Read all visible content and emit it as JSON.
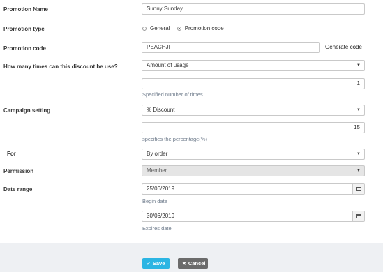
{
  "form": {
    "promotion_name": {
      "label": "Promotion Name",
      "value": "Sunny Sunday"
    },
    "promotion_type": {
      "label": "Promotion type",
      "options": [
        {
          "label": "General",
          "checked": false
        },
        {
          "label": "Promotion code",
          "checked": true
        }
      ]
    },
    "promotion_code": {
      "label": "Promotion code",
      "value": "PEACHJI",
      "generate_label": "Generate code"
    },
    "usage": {
      "label": "How many times can this discount be use?",
      "select_value": "Amount of usage",
      "count_value": "1",
      "help": "Specified number of times"
    },
    "campaign": {
      "label": "Campaign setting",
      "select_value": "% Discount",
      "percent_value": "15",
      "help": "specifies the percentage(%)"
    },
    "for": {
      "label": "For",
      "select_value": "By order"
    },
    "permission": {
      "label": "Permission",
      "select_value": "Member"
    },
    "date_range": {
      "label": "Date range",
      "begin_value": "25/06/2019",
      "begin_help": "Begin date",
      "end_value": "30/06/2019",
      "end_help": "Expires date"
    }
  },
  "footer": {
    "save_label": "Save",
    "cancel_label": "Cancel"
  },
  "icons": {
    "caret": "caret-down-icon",
    "calendar": "calendar-icon",
    "save": "check-icon",
    "cancel": "close-icon"
  }
}
